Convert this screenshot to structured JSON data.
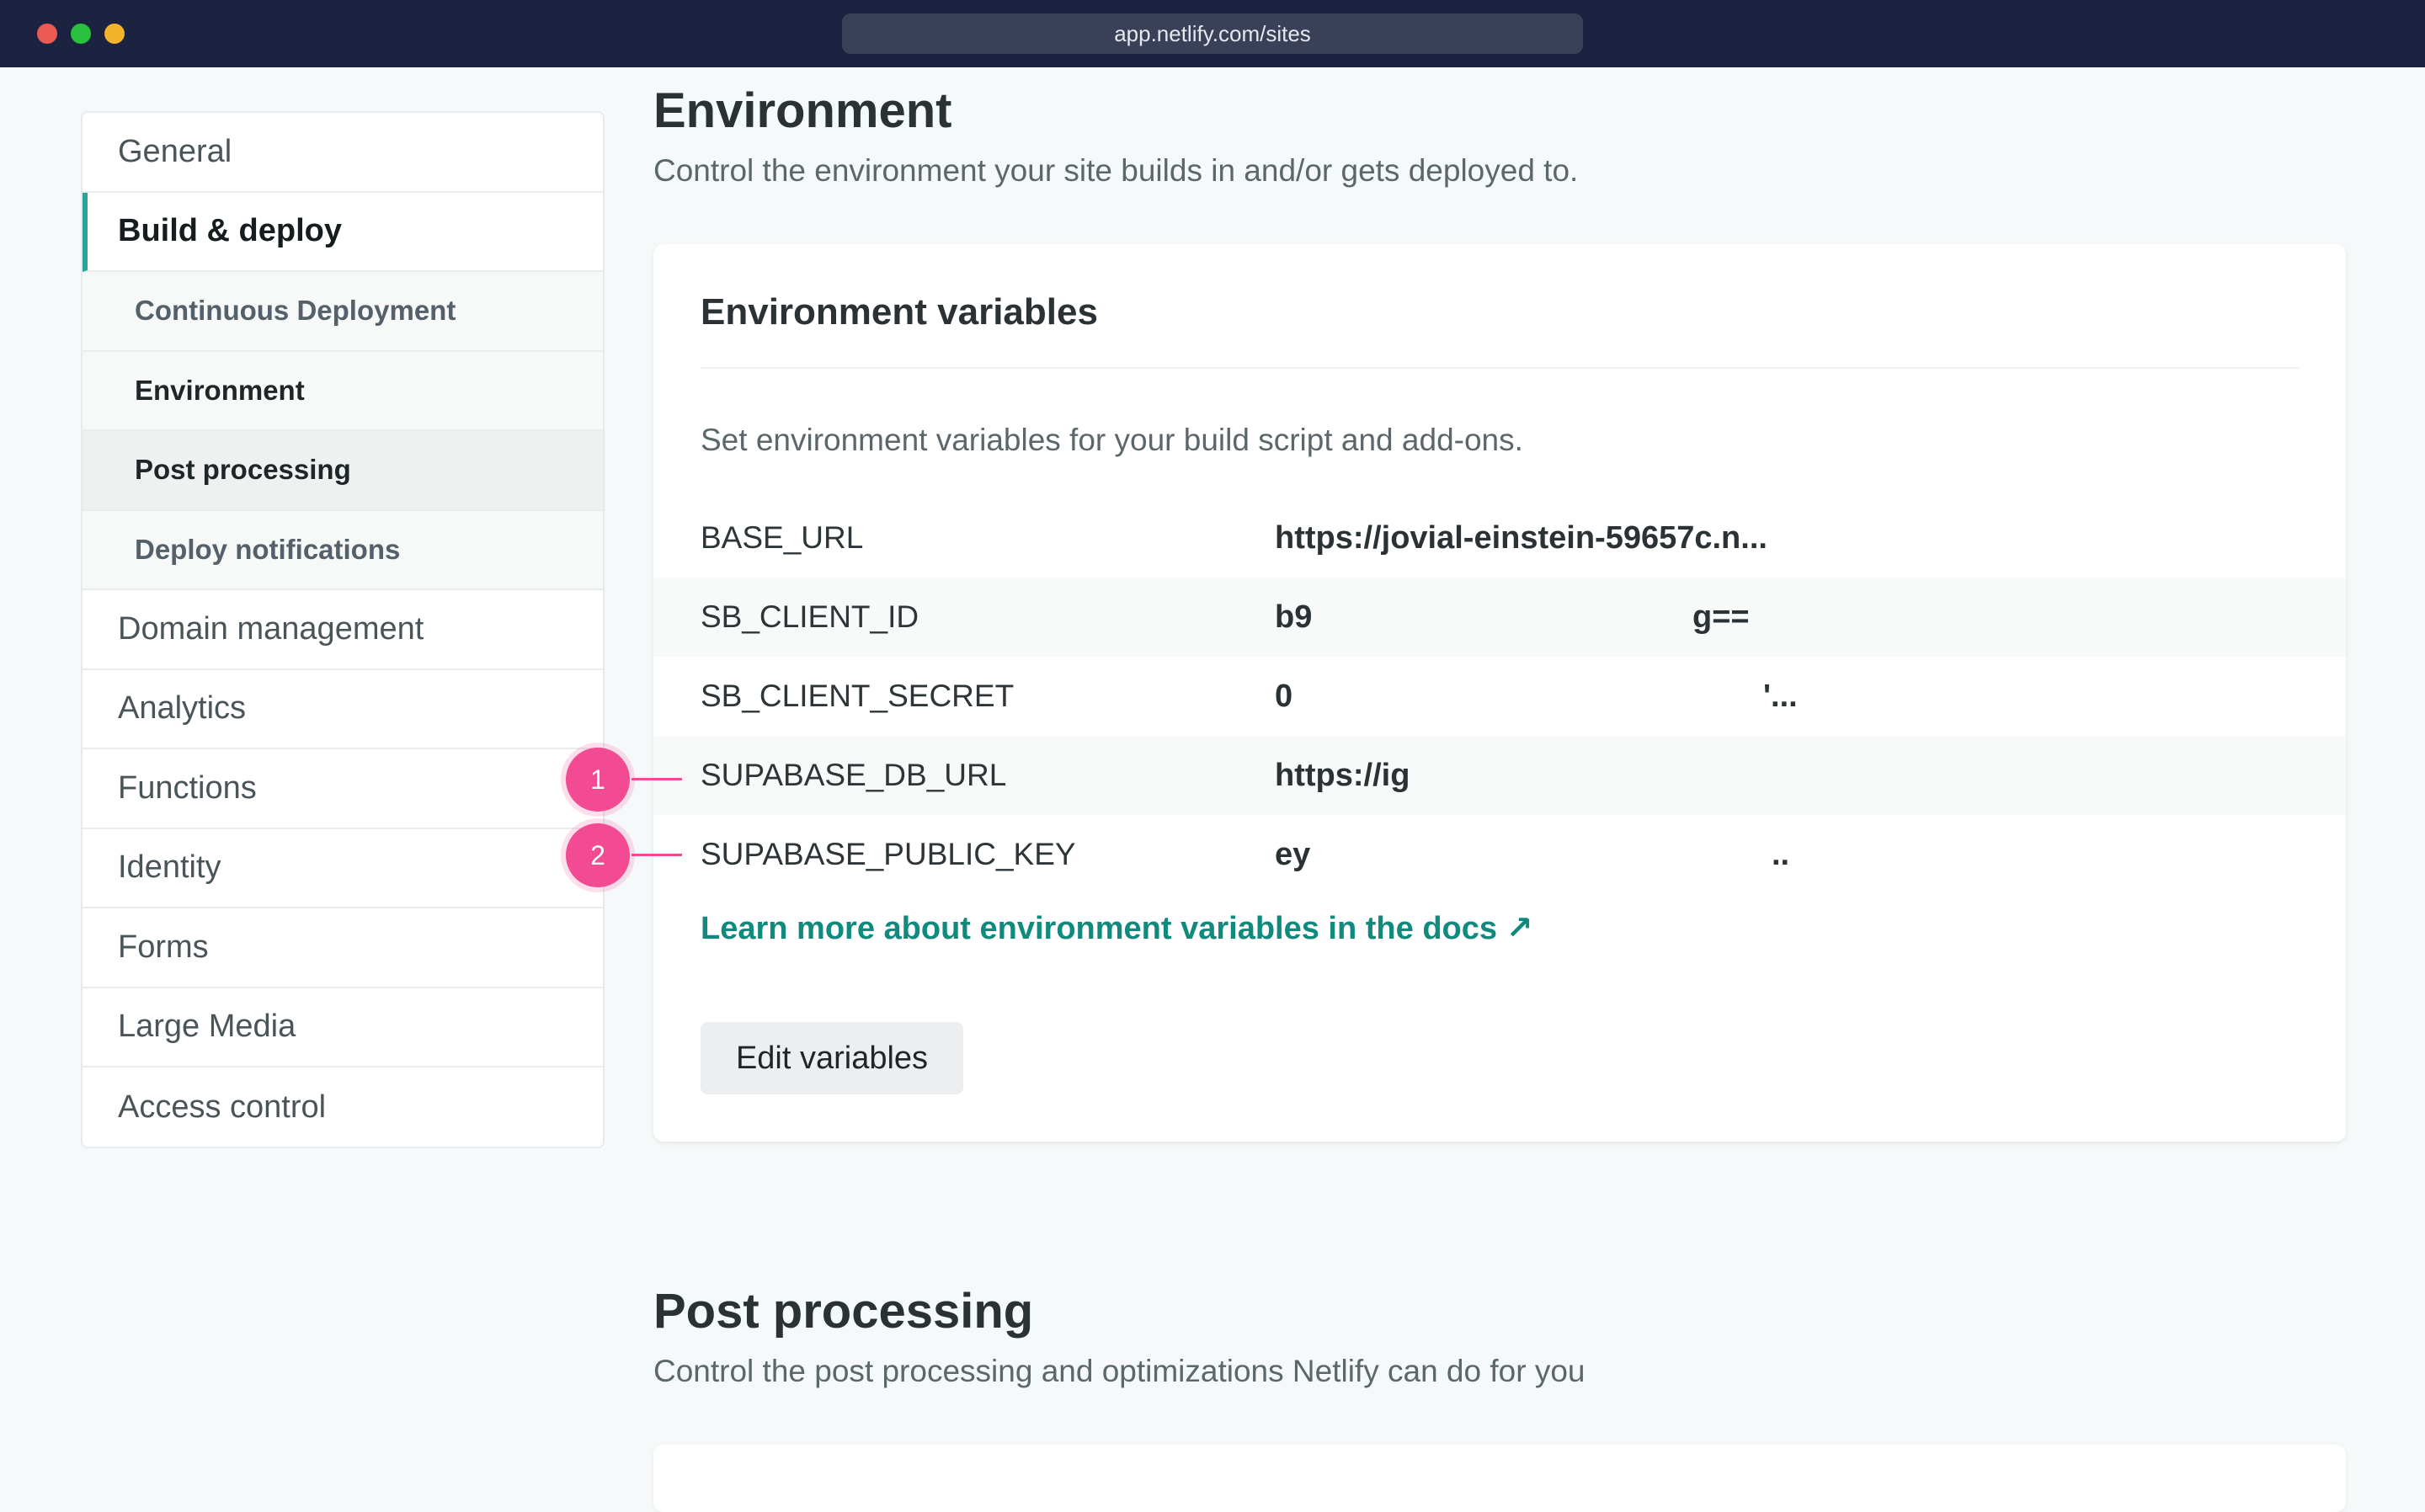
{
  "browser": {
    "url": "app.netlify.com/sites",
    "traffic_colors": [
      "#ee5b55",
      "#2ac23f",
      "#f3b32c"
    ]
  },
  "sidebar": {
    "items": [
      {
        "label": "General"
      },
      {
        "label": "Build & deploy",
        "active": true
      },
      {
        "label": "Continuous Deployment",
        "sub": true
      },
      {
        "label": "Environment",
        "sub": true,
        "current": true
      },
      {
        "label": "Post processing",
        "sub": true
      },
      {
        "label": "Deploy notifications",
        "sub": true
      },
      {
        "label": "Domain management"
      },
      {
        "label": "Analytics"
      },
      {
        "label": "Functions"
      },
      {
        "label": "Identity"
      },
      {
        "label": "Forms"
      },
      {
        "label": "Large Media"
      },
      {
        "label": "Access control"
      }
    ]
  },
  "environment": {
    "title": "Environment",
    "description": "Control the environment your site builds in and/or gets deployed to.",
    "card": {
      "title": "Environment variables",
      "description": "Set environment variables for your build script and add-ons.",
      "variables": [
        {
          "key": "BASE_URL",
          "value": "https://jovial-einstein-59657c.n...",
          "tail": ""
        },
        {
          "key": "SB_CLIENT_ID",
          "value": "b9",
          "tail": "g=="
        },
        {
          "key": "SB_CLIENT_SECRET",
          "value": "0",
          "tail": "'..."
        },
        {
          "key": "SUPABASE_DB_URL",
          "value": "https://ig",
          "tail": ""
        },
        {
          "key": "SUPABASE_PUBLIC_KEY",
          "value": "ey",
          "tail": ".."
        }
      ],
      "docs_link": "Learn more about environment variables in the docs ↗",
      "edit_button": "Edit variables"
    }
  },
  "post_processing": {
    "title": "Post processing",
    "description": "Control the post processing and optimizations Netlify can do for you"
  },
  "markers": [
    "1",
    "2"
  ],
  "colors": {
    "accent": "#2aa49a",
    "link": "#0f8a7c",
    "marker": "#f24b93",
    "titlebar": "#1c2340"
  }
}
